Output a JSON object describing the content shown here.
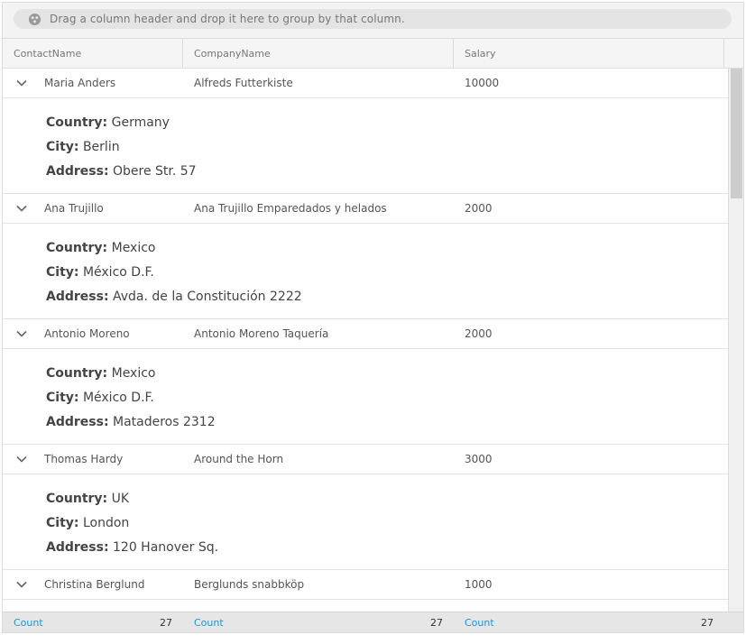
{
  "group_panel": {
    "hint": "Drag a column header and drop it here to group by that column.",
    "icon": "group-drag-icon"
  },
  "columns": [
    {
      "label": "ContactName"
    },
    {
      "label": "CompanyName"
    },
    {
      "label": "Salary"
    }
  ],
  "rows": [
    {
      "contact": "Maria Anders",
      "company": "Alfreds Futterkiste",
      "salary": "10000",
      "detail": {
        "country_key": "Country:",
        "country": "Germany",
        "city_key": "City:",
        "city": "Berlin",
        "address_key": "Address:",
        "address": "Obere Str. 57"
      }
    },
    {
      "contact": "Ana Trujillo",
      "company": "Ana Trujillo Emparedados y helados",
      "salary": "2000",
      "detail": {
        "country_key": "Country:",
        "country": "Mexico",
        "city_key": "City:",
        "city": "México D.F.",
        "address_key": "Address:",
        "address": "Avda. de la Constitución 2222"
      }
    },
    {
      "contact": "Antonio Moreno",
      "company": "Antonio Moreno Taquería",
      "salary": "2000",
      "detail": {
        "country_key": "Country:",
        "country": "Mexico",
        "city_key": "City:",
        "city": "México D.F.",
        "address_key": "Address:",
        "address": "Mataderos 2312"
      }
    },
    {
      "contact": "Thomas Hardy",
      "company": "Around the Horn",
      "salary": "3000",
      "detail": {
        "country_key": "Country:",
        "country": "UK",
        "city_key": "City:",
        "city": "London",
        "address_key": "Address:",
        "address": "120 Hanover Sq."
      }
    },
    {
      "contact": "Christina Berglund",
      "company": "Berglunds snabbköp",
      "salary": "1000"
    }
  ],
  "summary": [
    {
      "label": "Count",
      "value": "27"
    },
    {
      "label": "Count",
      "value": "27"
    },
    {
      "label": "Count",
      "value": "27"
    }
  ],
  "colors": {
    "accent": "#2196d3",
    "header_bg": "#f5f5f5",
    "footer_bg": "#e6e6e6"
  }
}
